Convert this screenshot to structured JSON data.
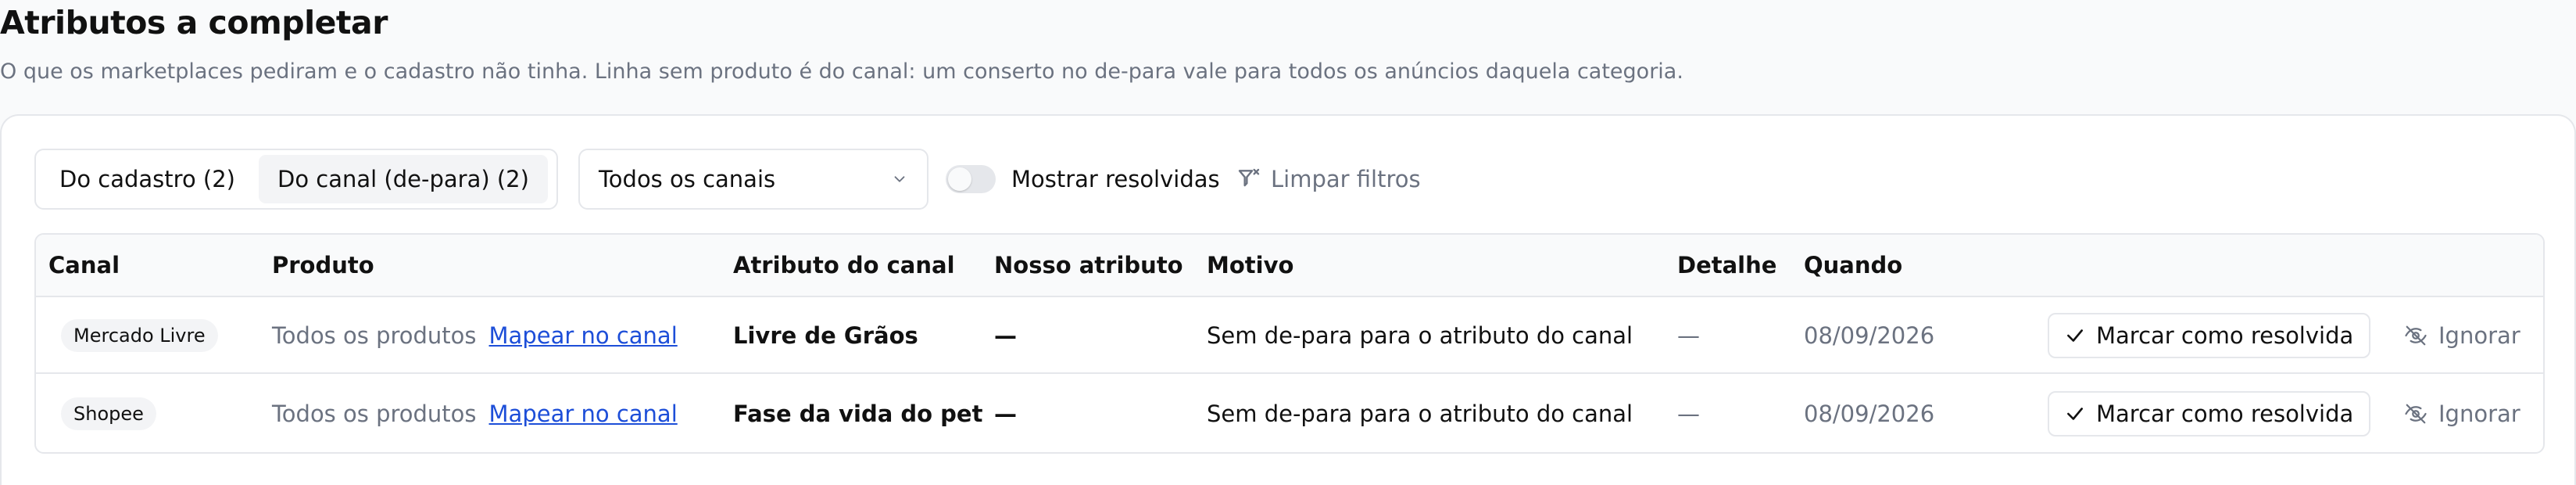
{
  "header": {
    "title": "Atributos a completar",
    "description": "O que os marketplaces pediram e o cadastro não tinha. Linha sem produto é do canal: um conserto no de-para vale para todos os anúncios daquela categoria."
  },
  "filters": {
    "tabs": [
      {
        "label": "Do cadastro (2)",
        "active": false
      },
      {
        "label": "Do canal (de-para) (2)",
        "active": true
      }
    ],
    "channel_select": {
      "value": "Todos os canais",
      "icon": "chevron-down-icon"
    },
    "toggle": {
      "label": "Mostrar resolvidas",
      "checked": false
    },
    "clear_filters": {
      "label": "Limpar filtros",
      "icon": "filter-x-icon"
    }
  },
  "table": {
    "columns": [
      "Canal",
      "Produto",
      "Atributo do canal",
      "Nosso atributo",
      "Motivo",
      "Detalhe",
      "Quando"
    ],
    "rows": [
      {
        "canal": "Mercado Livre",
        "produto": "Todos os produtos",
        "produto_link": "Mapear no canal",
        "atributo_canal": "Livre de Grãos",
        "nosso_atributo": "—",
        "motivo": "Sem de-para para o atributo do canal",
        "detalhe": "—",
        "quando": "08/09/2026",
        "resolve_label": "Marcar como resolvida",
        "ignore_label": "Ignorar"
      },
      {
        "canal": "Shopee",
        "produto": "Todos os produtos",
        "produto_link": "Mapear no canal",
        "atributo_canal": "Fase da vida do pet",
        "nosso_atributo": "—",
        "motivo": "Sem de-para para o atributo do canal",
        "detalhe": "—",
        "quando": "08/09/2026",
        "resolve_label": "Marcar como resolvida",
        "ignore_label": "Ignorar"
      }
    ]
  },
  "colors": {
    "link": "#1d4ed8",
    "muted_text": "#6b7280",
    "border": "#e5e7eb",
    "chip_bg": "#f3f4f6"
  }
}
